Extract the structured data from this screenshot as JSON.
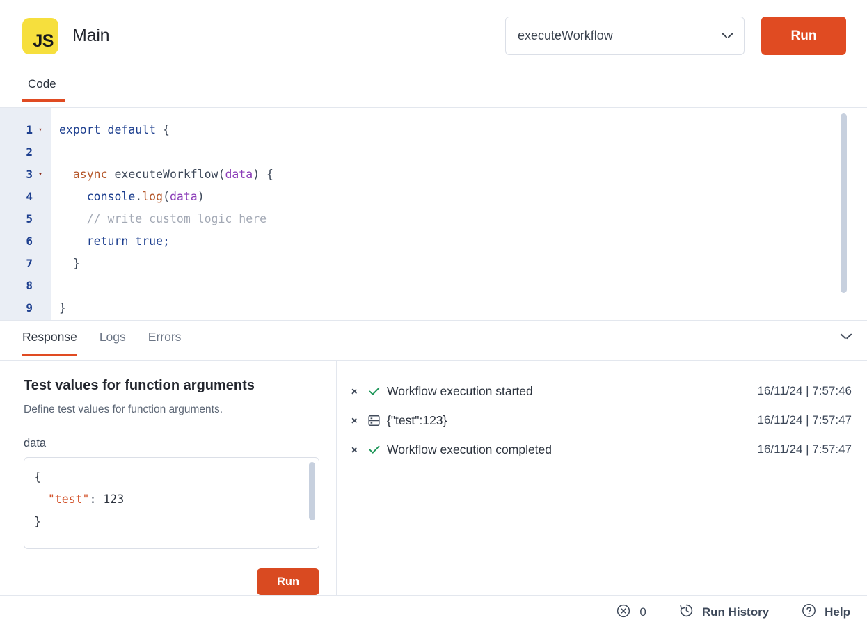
{
  "header": {
    "logo_text": "JS",
    "logo_icon": "js-logo-icon",
    "title": "Main",
    "function_select": {
      "value": "executeWorkflow",
      "chevron_icon": "chevron-down-icon"
    },
    "run_label": "Run"
  },
  "code_panel": {
    "tabs": [
      {
        "label": "Code",
        "active": true
      }
    ],
    "lines": [
      {
        "num": "1",
        "fold": "▾"
      },
      {
        "num": "2",
        "fold": ""
      },
      {
        "num": "3",
        "fold": "▾"
      },
      {
        "num": "4",
        "fold": ""
      },
      {
        "num": "5",
        "fold": ""
      },
      {
        "num": "6",
        "fold": ""
      },
      {
        "num": "7",
        "fold": ""
      },
      {
        "num": "8",
        "fold": ""
      },
      {
        "num": "9",
        "fold": ""
      }
    ],
    "code_text": [
      "export default {",
      "",
      "  async executeWorkflow(data) {",
      "    console.log(data)",
      "    // write custom logic here",
      "    return true;",
      "  }",
      "",
      "}"
    ]
  },
  "response_panel": {
    "tabs": [
      {
        "label": "Response",
        "active": true
      },
      {
        "label": "Logs",
        "active": false
      },
      {
        "label": "Errors",
        "active": false
      }
    ],
    "collapse_icon": "chevron-down-icon"
  },
  "test_values": {
    "title": "Test values for function arguments",
    "description": "Define test values for function arguments.",
    "field_label": "data",
    "json_lines": [
      "{",
      "  \"test\": 123",
      "}"
    ],
    "json_key": "\"test\"",
    "json_value": "123",
    "run_label": "Run"
  },
  "logs": [
    {
      "message": "Workflow execution started",
      "timestamp": "16/11/24 | 7:57:46",
      "icon": "check-icon",
      "expand_icon": "chevron-right-icon"
    },
    {
      "message": "{\"test\":123}",
      "timestamp": "16/11/24 | 7:57:47",
      "icon": "table-icon",
      "expand_icon": "chevron-right-icon"
    },
    {
      "message": "Workflow execution completed",
      "timestamp": "16/11/24 | 7:57:47",
      "icon": "check-icon",
      "expand_icon": "chevron-right-icon"
    }
  ],
  "footer": {
    "error_count": "0",
    "error_icon": "error-circle-icon",
    "run_history_label": "Run History",
    "run_history_icon": "history-icon",
    "help_label": "Help",
    "help_icon": "question-circle-icon"
  },
  "colors": {
    "accent": "#e04b22",
    "js_yellow": "#f6df3d",
    "check_green": "#1a9456",
    "text": "#2c333e"
  }
}
